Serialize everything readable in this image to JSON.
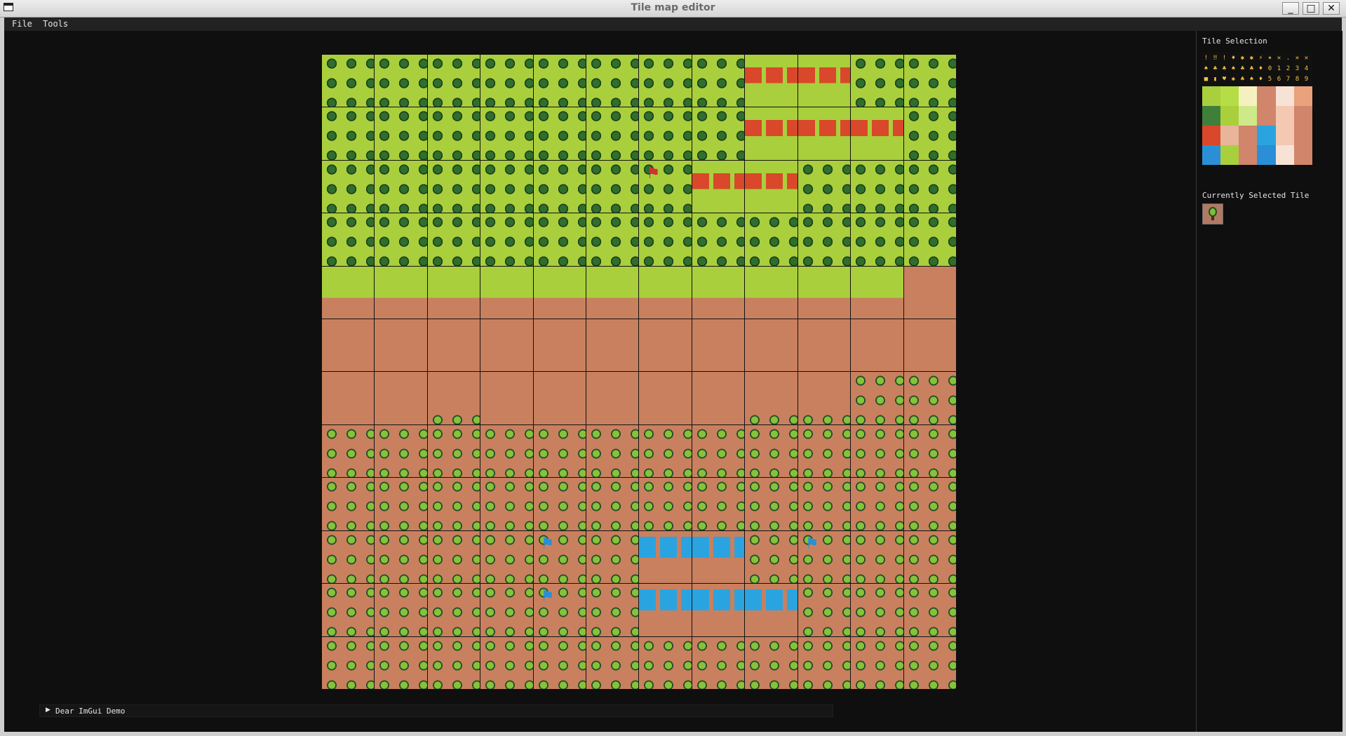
{
  "window": {
    "title": "Tile map editor",
    "controls": {
      "minimize": "_",
      "maximize": "□",
      "close": "✕"
    }
  },
  "menubar": {
    "file": "File",
    "tools": "Tools"
  },
  "map": {
    "legend": {
      "G": "grass",
      "F": "forest",
      "D": "dirt",
      "T": "dirt-forest",
      "S": "dirt-sparse-trees",
      "A": "grass-dirt-edge",
      "B": "grass-dirt-edge-low",
      "H": "red-houses",
      "R": "red-flag",
      "U": "blue-houses",
      "L": "blue-flag"
    },
    "rows": [
      "FFFFFFFFHHFF",
      "FFFFFFFFHHHF",
      "FFFFFFRHHFFF",
      "FFFFFFFFFFFF",
      "AAAAAAAAAAAD",
      "DDDDDDDDDDDD",
      "DDSDDDDDSSTT",
      "TTTTTTTTTTTT",
      "TTTTTTTTTTTT",
      "TTTTLTUUTLTT",
      "TTTTLTUUUTTT",
      "TTTTTTTTTTTT"
    ]
  },
  "panel": {
    "tile_selection_label": "Tile Selection",
    "currently_selected_label": "Currently Selected Tile",
    "selected_tile": "tree-on-dirt",
    "tileset_icons_row1": [
      "!",
      "‼",
      "!",
      "♦",
      "✱",
      "✱",
      "⚡",
      "✶",
      "✕",
      ".",
      "✕",
      "✕"
    ],
    "tileset_icons_row2": [
      "♠",
      "♣",
      "♣",
      "♠",
      "♣",
      "♣",
      "♦",
      "0",
      "1",
      "2",
      "3",
      "4"
    ],
    "tileset_icons_row3": [
      "■",
      "▮",
      "♥",
      "✱",
      "♣",
      "♠",
      "♦",
      "5",
      "6",
      "7",
      "8",
      "9"
    ]
  },
  "footer": {
    "demo_window": "Dear ImGui Demo"
  }
}
